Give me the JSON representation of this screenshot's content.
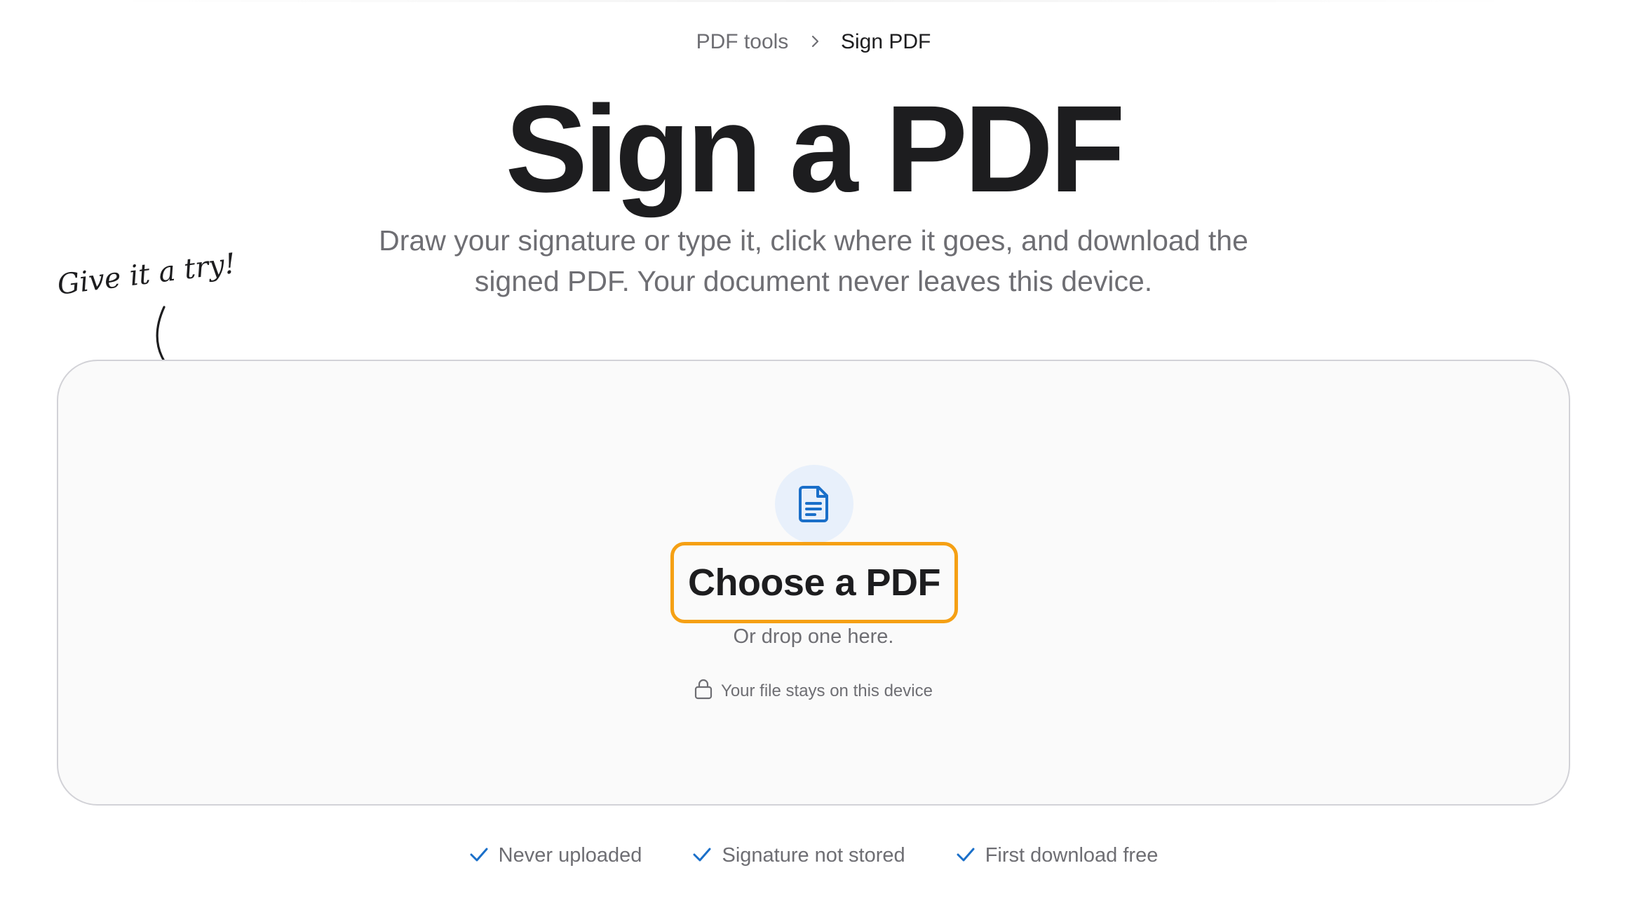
{
  "breadcrumb": {
    "parent": "PDF tools",
    "current": "Sign PDF",
    "separator_icon": "chevron-right-icon"
  },
  "header": {
    "title": "Sign a PDF",
    "subtitle": "Draw your signature or type it, click where it goes, and download the signed PDF. Your document never leaves this device."
  },
  "hint": {
    "text": "Give it a try!",
    "icon": "curved-arrow-icon"
  },
  "dropzone": {
    "icon": "file-document-icon",
    "button_label": "Choose a PDF",
    "drop_text": "Or drop one here.",
    "privacy_text": "Your file stays on this device",
    "privacy_icon": "lock-icon"
  },
  "features": [
    {
      "label": "Never uploaded",
      "icon": "check-icon"
    },
    {
      "label": "Signature not stored",
      "icon": "check-icon"
    },
    {
      "label": "First download free",
      "icon": "check-icon"
    }
  ],
  "colors": {
    "accent": "#1a6fc9",
    "button_outline": "#f5a014",
    "text": "#1d1d1f",
    "muted": "#6e6e73",
    "icon_bg": "#e8f0fb"
  }
}
